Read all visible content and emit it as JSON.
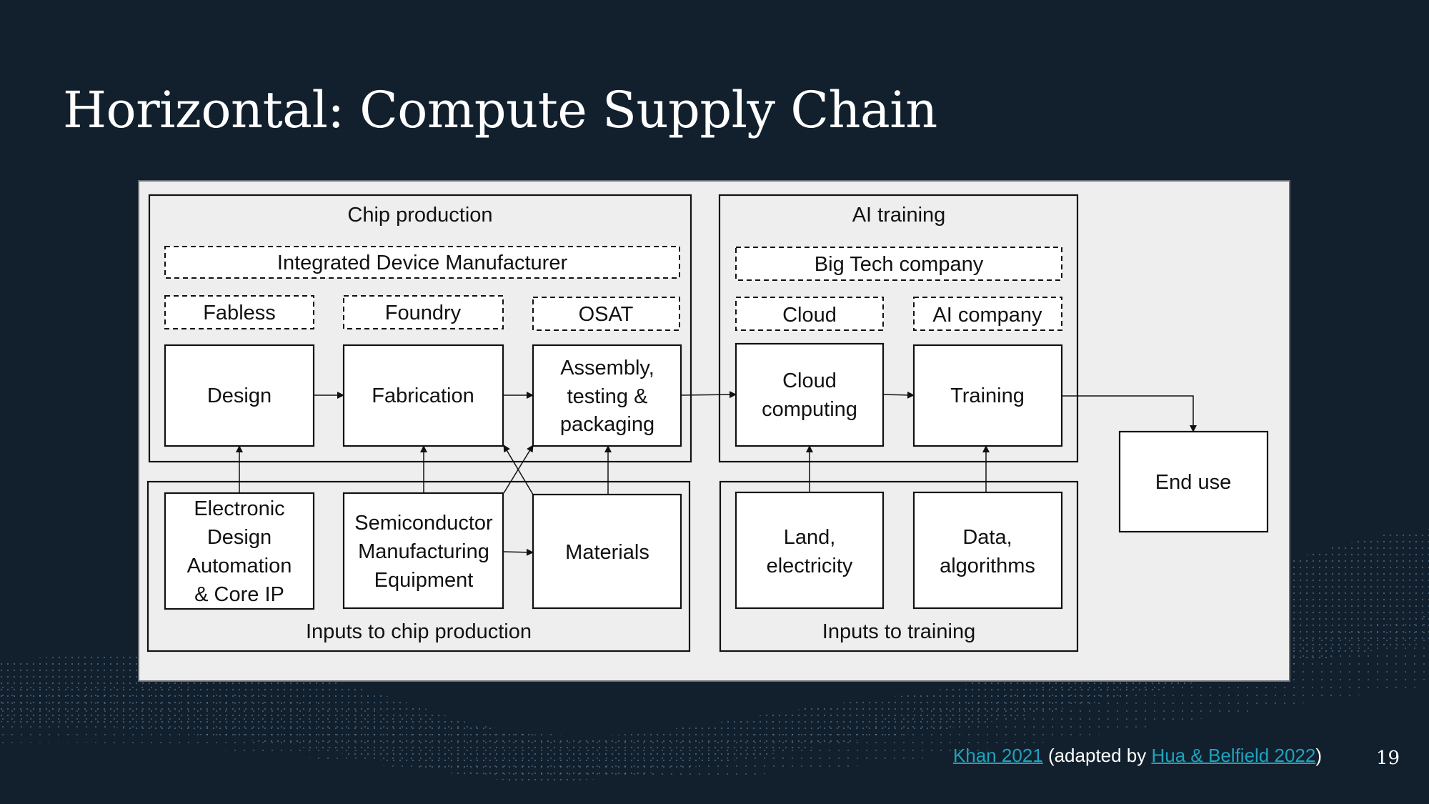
{
  "slide": {
    "title": "Horizontal: Compute Supply Chain",
    "page_number": "19",
    "colors": {
      "background": "#12202d",
      "panel": "#eeeeee",
      "link": "#1fa3bd",
      "text": "#ffffff"
    }
  },
  "diagram": {
    "groups": {
      "chip_production": "Chip production",
      "ai_training": "AI training",
      "inputs_chip": "Inputs to chip production",
      "inputs_training": "Inputs to training"
    },
    "org_labels": {
      "idm": "Integrated Device Manufacturer",
      "fabless": "Fabless",
      "foundry": "Foundry",
      "osat": "OSAT",
      "big_tech": "Big Tech company",
      "cloud": "Cloud",
      "ai_company": "AI company"
    },
    "nodes": {
      "design": [
        "Design"
      ],
      "fabrication": [
        "Fabrication"
      ],
      "atp": [
        "Assembly,",
        "testing &",
        "packaging"
      ],
      "cloud_computing": [
        "Cloud",
        "computing"
      ],
      "training": [
        "Training"
      ],
      "end_use": [
        "End use"
      ],
      "eda": [
        "Electronic",
        "Design",
        "Automation",
        "& Core IP"
      ],
      "sme": [
        "Semiconductor",
        "Manufacturing",
        "Equipment"
      ],
      "materials": [
        "Materials"
      ],
      "land": [
        "Land,",
        "electricity"
      ],
      "data": [
        "Data,",
        "algorithms"
      ]
    },
    "edges": [
      [
        "design",
        "fabrication"
      ],
      [
        "fabrication",
        "atp"
      ],
      [
        "atp",
        "cloud_computing"
      ],
      [
        "cloud_computing",
        "training"
      ],
      [
        "training",
        "end_use"
      ],
      [
        "eda",
        "design"
      ],
      [
        "sme",
        "fabrication"
      ],
      [
        "sme",
        "atp"
      ],
      [
        "sme",
        "materials"
      ],
      [
        "materials",
        "fabrication"
      ],
      [
        "materials",
        "atp"
      ],
      [
        "land",
        "cloud_computing"
      ],
      [
        "data",
        "training"
      ]
    ]
  },
  "footer": {
    "link1": "Khan 2021",
    "middle": " (adapted by ",
    "link2": "Hua & Belfield 2022",
    "end": ")"
  }
}
